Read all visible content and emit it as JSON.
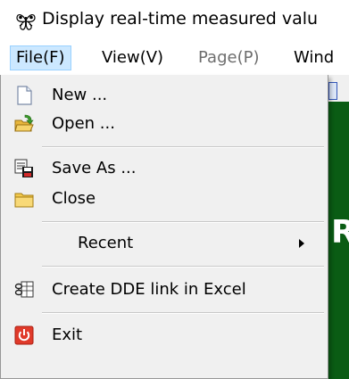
{
  "window": {
    "title": "Display real-time measured valu",
    "app_icon": "butterfly-icon"
  },
  "menubar": {
    "items": [
      {
        "label": "File(F)",
        "state": "open"
      },
      {
        "label": "View(V)",
        "state": "normal"
      },
      {
        "label": "Page(P)",
        "state": "disabled"
      },
      {
        "label": "Wind",
        "state": "normal"
      }
    ]
  },
  "file_menu": {
    "items": [
      {
        "label": "New ...",
        "icon": "new-document-icon"
      },
      {
        "label": "Open ...",
        "icon": "open-folder-icon"
      },
      {
        "label": "Save As ...",
        "icon": "save-as-icon"
      },
      {
        "label": "Close",
        "icon": "close-folder-icon"
      },
      {
        "label": "Recent",
        "icon": "",
        "submenu": true
      },
      {
        "label": "Create DDE link in Excel",
        "icon": "dde-link-icon"
      },
      {
        "label": "Exit",
        "icon": "exit-icon"
      }
    ]
  },
  "background": {
    "partial_letter": "R"
  },
  "colors": {
    "menu_active_bg": "#cce8ff",
    "menu_active_border": "#99d1ff",
    "dropdown_bg": "#f0f0f0",
    "app_background": "#0a5c14",
    "disabled_text": "#6d6d6d"
  }
}
